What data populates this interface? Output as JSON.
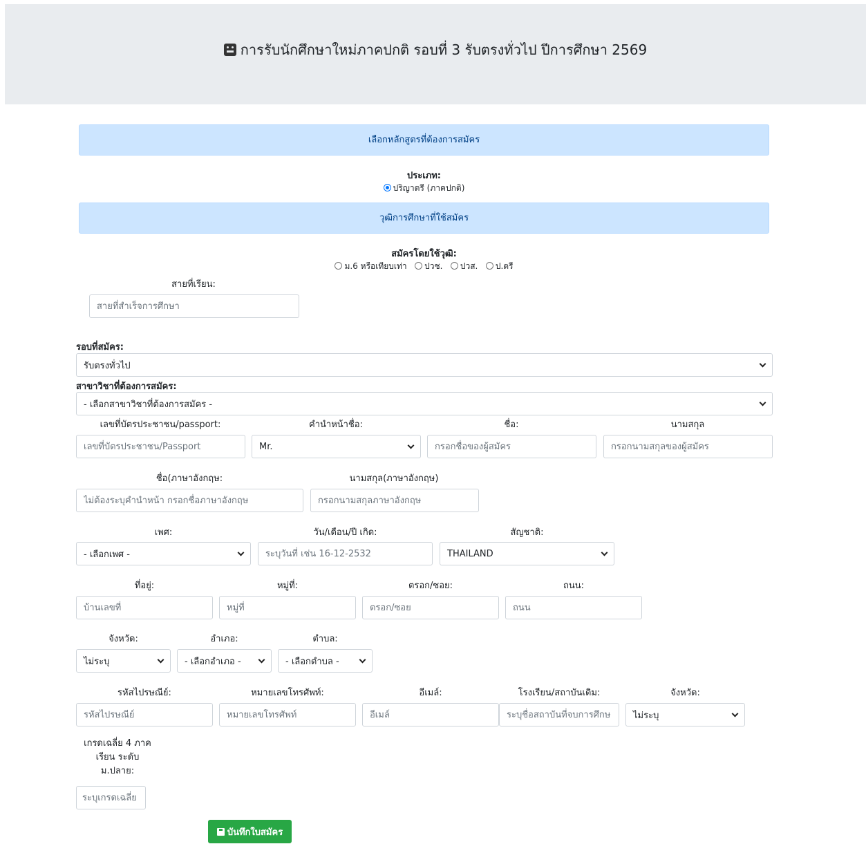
{
  "header": {
    "title": "การรับนักศึกษาใหม่ภาคปกติ รอบที่ 3 รับตรงทั่วไป ปีการศึกษา 2569",
    "icon": "user-secret-icon"
  },
  "section_course": {
    "heading": "เลือกหลักสูตรที่ต้องการสมัคร",
    "type_label": "ประเภท:",
    "type_option": "ปริญาตรี (ภาคปกติ)"
  },
  "section_qualification": {
    "heading": "วุฒิการศึกษาที่ใช้สมัคร",
    "apply_label": "สมัครโดยใช้วุฒิ:",
    "options": [
      "ม.6 หรือเทียบเท่า",
      "ปวช.",
      "ปวส.",
      "ป.ตรี"
    ],
    "stream_label": "สายที่เรียน:",
    "stream_placeholder": "สายที่สำเร็จการศึกษา"
  },
  "round": {
    "label": "รอบที่สมัคร:",
    "value": "รับตรงทั่วไป"
  },
  "major": {
    "label": "สาขาวิชาที่ต้องการสมัคร:",
    "value": "- เลือกสาขาวิชาที่ต้องการสมัคร -"
  },
  "personal": {
    "id_label": "เลขที่บัตรประชาชน/passport:",
    "id_placeholder": "เลขที่บัตรประชาชน/Passport",
    "prefix_label": "คำนำหน้าชื่อ:",
    "prefix_value": "Mr.",
    "name_label": "ชื่อ:",
    "name_placeholder": "กรอกชื่อของผู้สมัคร",
    "surname_label": "นามสกุล",
    "surname_placeholder": "กรอกนามสกุลของผู้สมัคร",
    "name_en_label": "ชื่อ(ภาษาอังกฤษ:",
    "name_en_placeholder": "ไม่ต้องระบุคำนำหน้า กรอกชื่อภาษาอังกฤษ",
    "surname_en_label": "นามสกุล(ภาษาอังกฤษ)",
    "surname_en_placeholder": "กรอกนามสกุลภาษาอังกฤษ",
    "gender_label": "เพศ:",
    "gender_value": "- เลือกเพศ -",
    "dob_label": "วัน/เดือน/ปี เกิด:",
    "dob_placeholder": "ระบุวันที่ เช่น 16-12-2532",
    "nationality_label": "สัญชาติ:",
    "nationality_value": "THAILAND"
  },
  "address": {
    "house_label": "ที่อยู่:",
    "house_placeholder": "บ้านเลขที่",
    "moo_label": "หมู่ที่:",
    "moo_placeholder": "หมู่ที่",
    "soi_label": "ตรอก/ซอย:",
    "soi_placeholder": "ตรอก/ซอย",
    "road_label": "ถนน:",
    "road_placeholder": "ถนน",
    "province_label": "จังหวัด:",
    "province_value": "ไม่ระบุ",
    "district_label": "อำเภอ:",
    "district_value": "- เลือกอำเภอ -",
    "subdistrict_label": "ตำบล:",
    "subdistrict_value": "- เลือกตำบล -",
    "postcode_label": "รหัสไปรษณีย์:",
    "postcode_placeholder": "รหัสไปรษณีย์",
    "phone_label": "หมายเลขโทรศัพท์:",
    "phone_placeholder": "หมายเลขโทรศัพท์",
    "email_label": "อีเมล์:",
    "email_placeholder": "อีเมล์",
    "school_label": "โรงเรียน/สถาบันเดิม:",
    "school_placeholder": "ระบุชื่อสถาบันที่จบการศึกษ",
    "school_province_label": "จังหวัด:",
    "school_province_value": "ไม่ระบุ"
  },
  "gpa": {
    "label_line1": "เกรดเฉลี่ย 4 ภาค",
    "label_line2": "เรียน ระดับ",
    "label_line3": "ม.ปลาย:",
    "placeholder": "ระบุเกรดเฉลี่ย"
  },
  "submit": {
    "label": "บันทึกใบสมัคร",
    "icon": "save-icon"
  },
  "colors": {
    "info_bg": "#cce5ff",
    "info_text": "#004085",
    "success": "#28a745",
    "jumbotron": "#e9ecef"
  }
}
